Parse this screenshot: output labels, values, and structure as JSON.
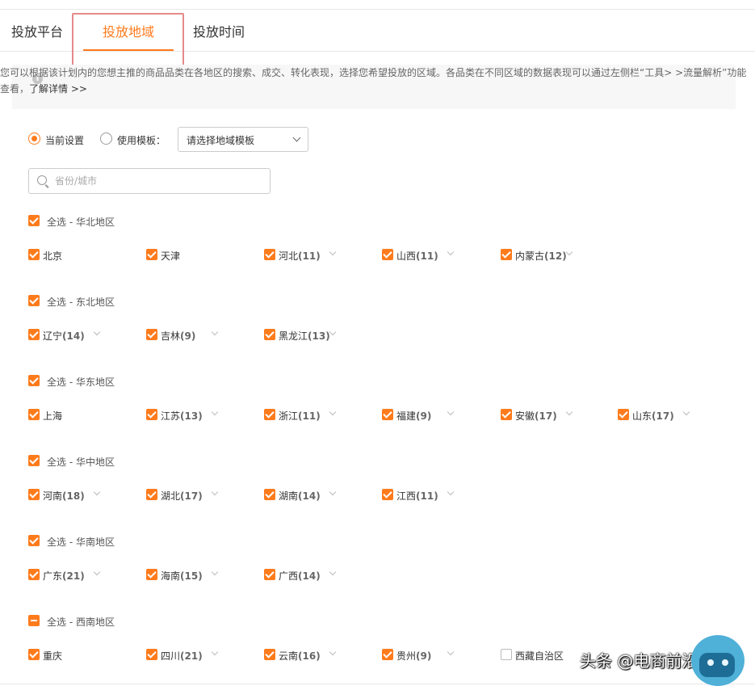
{
  "tabs": [
    {
      "label": "投放平台",
      "active": false
    },
    {
      "label": "投放地域",
      "active": true
    },
    {
      "label": "投放时间",
      "active": false
    }
  ],
  "notice": {
    "line1": "您可以根据该计划内的您想主推的商品品类在各地区的搜索、成交、转化表现，选择您希望投放的区域。各品类在不同区域的数据表现可以通过左侧栏“工具>",
    "line2_prefix": ">流量解析”功能查看，",
    "link": "了解详情 >>"
  },
  "mode": {
    "current_label": "当前设置",
    "template_label": "使用模板：",
    "template_placeholder": "请选择地域模板"
  },
  "search": {
    "placeholder": "省份/城市"
  },
  "groups": [
    {
      "label": "全选 - 华北地区",
      "state": "checked",
      "regions": [
        {
          "name": "北京",
          "count": ""
        },
        {
          "name": "天津",
          "count": ""
        },
        {
          "name": "河北",
          "count": "(11)"
        },
        {
          "name": "山西",
          "count": "(11)"
        },
        {
          "name": "内蒙古",
          "count": "(12)"
        }
      ]
    },
    {
      "label": "全选 - 东北地区",
      "state": "checked",
      "regions": [
        {
          "name": "辽宁",
          "count": "(14)"
        },
        {
          "name": "吉林",
          "count": "(9)"
        },
        {
          "name": "黑龙江",
          "count": "(13)"
        }
      ]
    },
    {
      "label": "全选 - 华东地区",
      "state": "checked",
      "regions": [
        {
          "name": "上海",
          "count": ""
        },
        {
          "name": "江苏",
          "count": "(13)"
        },
        {
          "name": "浙江",
          "count": "(11)"
        },
        {
          "name": "福建",
          "count": "(9)"
        },
        {
          "name": "安徽",
          "count": "(17)"
        },
        {
          "name": "山东",
          "count": "(17)"
        }
      ]
    },
    {
      "label": "全选 - 华中地区",
      "state": "checked",
      "regions": [
        {
          "name": "河南",
          "count": "(18)"
        },
        {
          "name": "湖北",
          "count": "(17)"
        },
        {
          "name": "湖南",
          "count": "(14)"
        },
        {
          "name": "江西",
          "count": "(11)"
        }
      ]
    },
    {
      "label": "全选 - 华南地区",
      "state": "checked",
      "regions": [
        {
          "name": "广东",
          "count": "(21)"
        },
        {
          "name": "海南",
          "count": "(15)"
        },
        {
          "name": "广西",
          "count": "(14)"
        }
      ]
    },
    {
      "label": "全选 - 西南地区",
      "state": "partial",
      "regions": [
        {
          "name": "重庆",
          "count": ""
        },
        {
          "name": "四川",
          "count": "(21)"
        },
        {
          "name": "云南",
          "count": "(16)"
        },
        {
          "name": "贵州",
          "count": "(9)"
        },
        {
          "name": "西藏自治区",
          "count": "",
          "unchecked": true
        }
      ]
    }
  ],
  "watermark": "头条 @电商前沿君",
  "colors": {
    "accent": "#ff7b1c",
    "highlight_box": "#e58a8a"
  }
}
